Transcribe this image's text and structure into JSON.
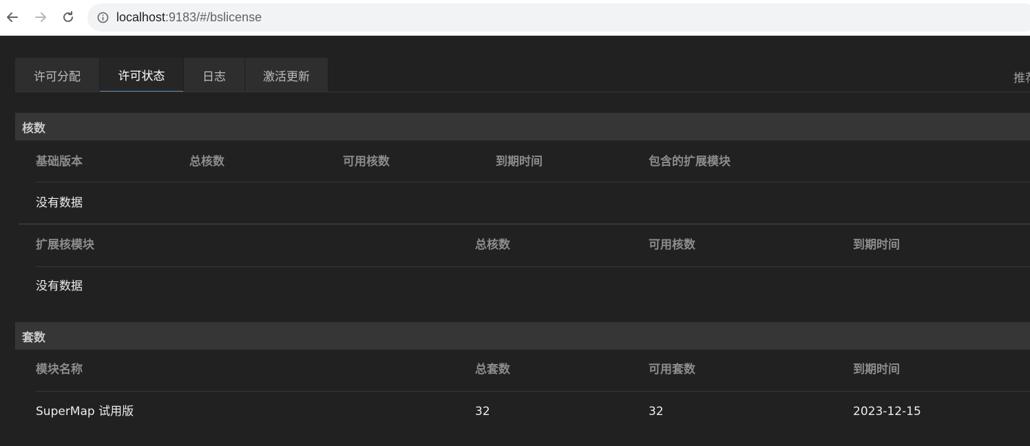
{
  "browser": {
    "url_host": "localhost",
    "url_rest": ":9183/#/bslicense"
  },
  "tabs": [
    {
      "label": "许可分配",
      "active": false
    },
    {
      "label": "许可状态",
      "active": true
    },
    {
      "label": "日志",
      "active": false
    },
    {
      "label": "激活更新",
      "active": false
    }
  ],
  "side_text": "推荐",
  "cores": {
    "title": "核数",
    "base_table": {
      "headers": [
        "基础版本",
        "总核数",
        "可用核数",
        "到期时间",
        "包含的扩展模块"
      ],
      "empty_text": "没有数据"
    },
    "ext_table": {
      "headers": [
        "扩展核模块",
        "总核数",
        "可用核数",
        "到期时间"
      ],
      "empty_text": "没有数据"
    }
  },
  "sets": {
    "title": "套数",
    "headers": [
      "模块名称",
      "总套数",
      "可用套数",
      "到期时间"
    ],
    "rows": [
      [
        "SuperMap 试用版",
        "32",
        "32",
        "2023-12-15"
      ]
    ]
  },
  "colors": {
    "background": "#212121",
    "section_header": "#363636",
    "active_tab_underline": "#3a8ee6"
  }
}
